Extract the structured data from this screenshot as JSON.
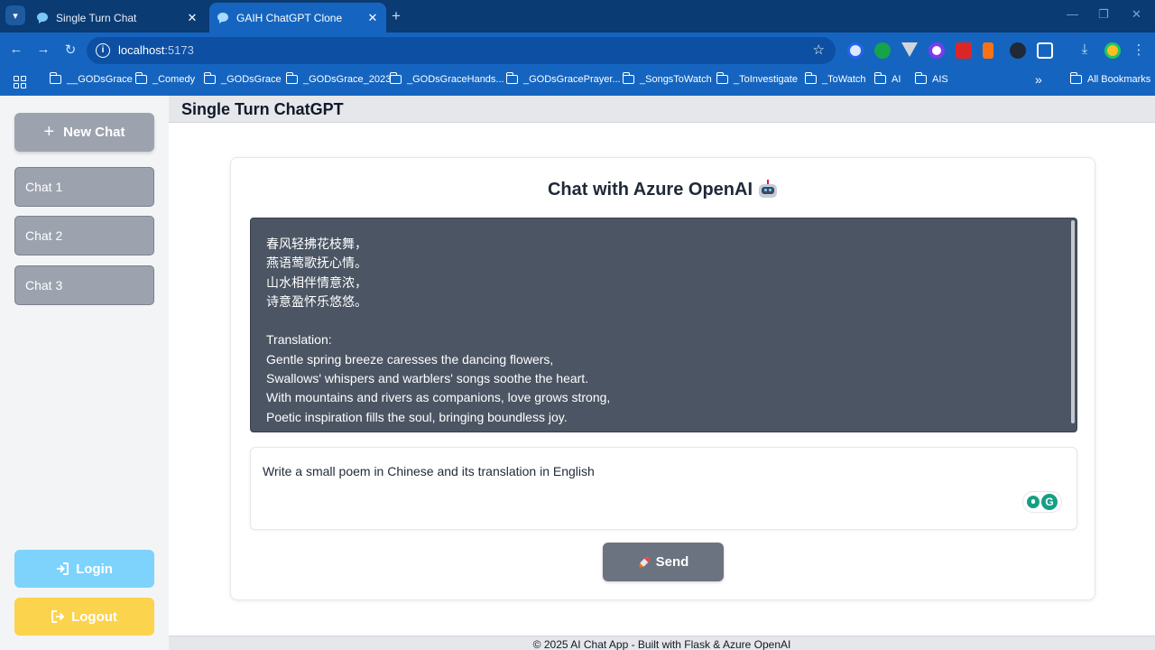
{
  "browser": {
    "tabs": [
      {
        "title": "Single Turn Chat",
        "close": "✕"
      },
      {
        "title": "GAIH ChatGPT Clone",
        "close": "✕"
      }
    ],
    "new_tab": "+",
    "url_host": "localhost",
    "url_port": ":5173",
    "star": "☆",
    "bookmarks": [
      "__GODsGrace",
      "_Comedy",
      "_GODsGrace",
      "_GODsGrace_2023",
      "_GODsGraceHands...",
      "_GODsGracePrayer...",
      "_SongsToWatch",
      "_ToInvestigate",
      "_ToWatch",
      "AI",
      "AIS"
    ],
    "overflow": "»",
    "all_bookmarks": "All Bookmarks",
    "accent": "#1565c0"
  },
  "app": {
    "header_title": "Single Turn ChatGPT",
    "sidebar": {
      "new_chat": "New Chat",
      "chats": [
        "Chat 1",
        "Chat 2",
        "Chat 3"
      ],
      "login": "Login",
      "logout": "Logout"
    },
    "card": {
      "title": "Chat with Azure OpenAI",
      "response_lines": [
        "春风轻拂花枝舞，",
        "燕语莺歌抚心情。",
        "山水相伴情意浓，",
        "诗意盈怀乐悠悠。",
        "",
        "Translation:",
        "Gentle spring breeze caresses the dancing flowers,",
        "Swallows' whispers and warblers' songs soothe the heart.",
        "With mountains and rivers as companions, love grows strong,",
        "Poetic inspiration fills the soul, bringing boundless joy."
      ],
      "prompt": "Write a small poem in Chinese and its translation in English",
      "send": "Send"
    },
    "footer": "© 2025 AI Chat App - Built with Flask & Azure OpenAI"
  }
}
